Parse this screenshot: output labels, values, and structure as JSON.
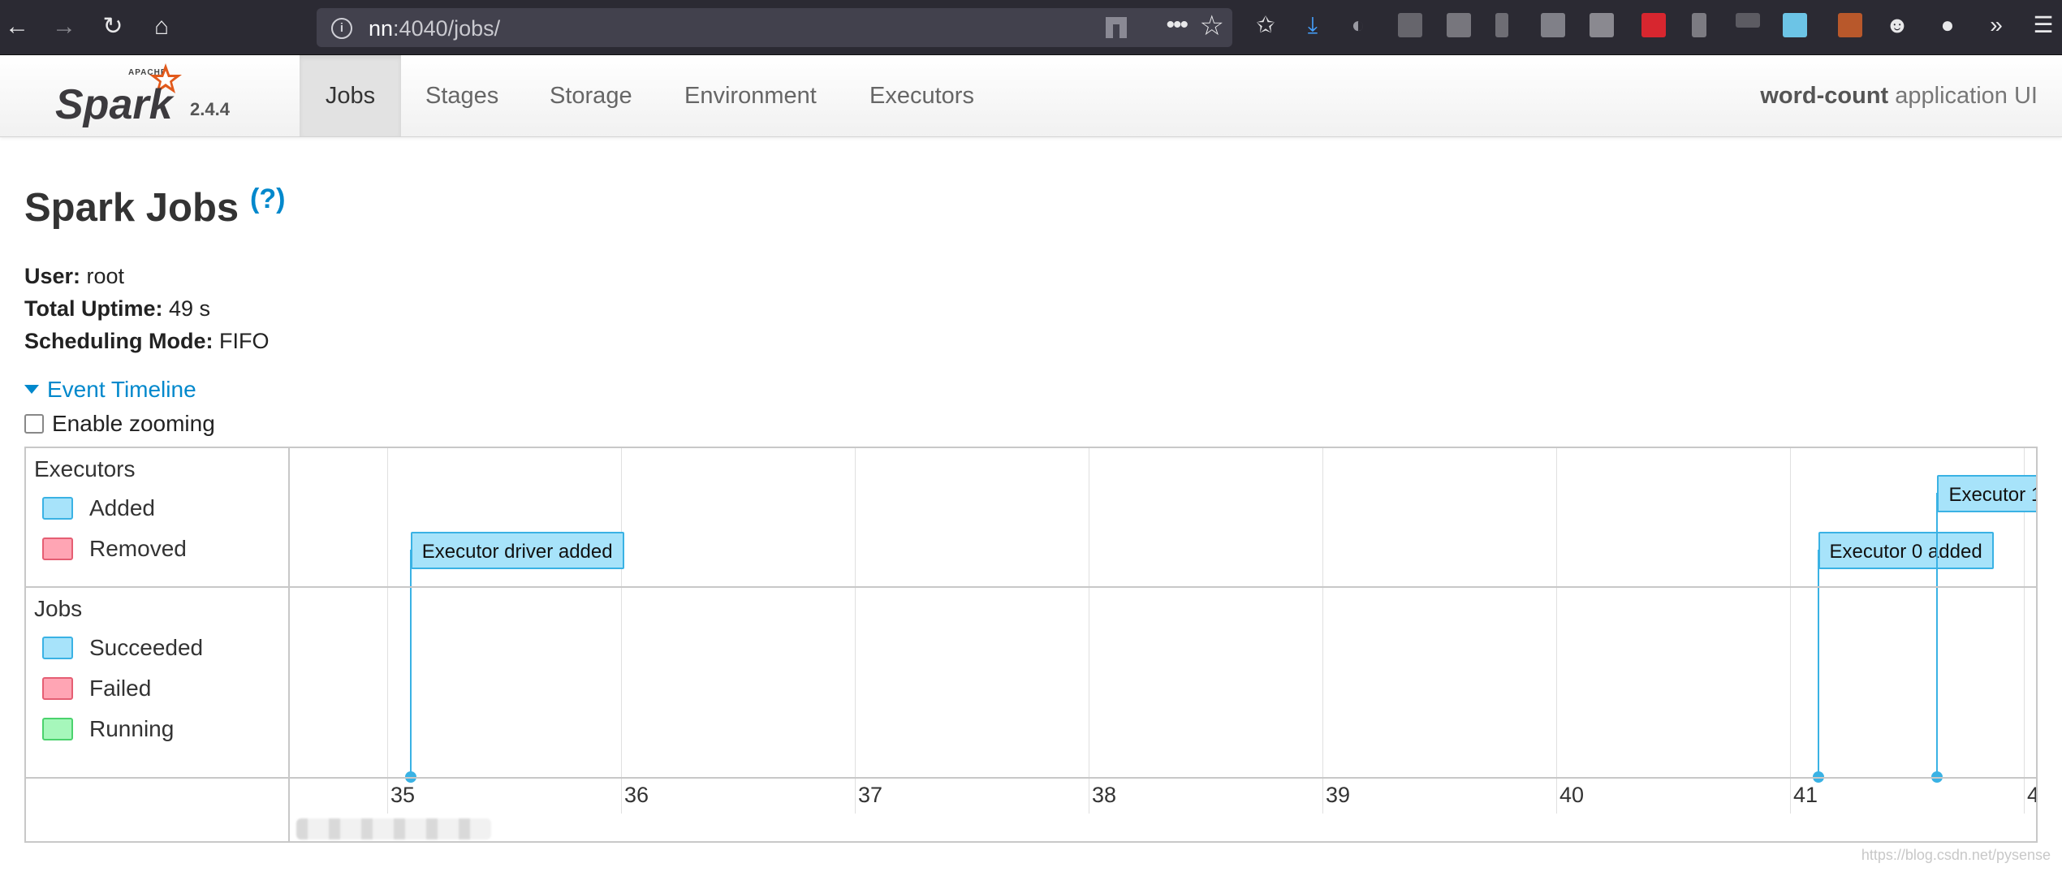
{
  "browser": {
    "url_host": "nn",
    "url_path": ":4040/jobs/"
  },
  "nav": {
    "version": "2.4.4",
    "tabs": [
      {
        "label": "Jobs",
        "active": true
      },
      {
        "label": "Stages",
        "active": false
      },
      {
        "label": "Storage",
        "active": false
      },
      {
        "label": "Environment",
        "active": false
      },
      {
        "label": "Executors",
        "active": false
      }
    ],
    "app_name": "word-count",
    "app_suffix": " application UI"
  },
  "page": {
    "title": "Spark Jobs",
    "help": "(?)",
    "info": [
      {
        "label": "User:",
        "value": " root"
      },
      {
        "label": "Total Uptime:",
        "value": " 49 s"
      },
      {
        "label": "Scheduling Mode:",
        "value": " FIFO"
      }
    ],
    "timeline_toggle": "Event Timeline",
    "enable_zooming": "Enable zooming",
    "enable_zooming_checked": false
  },
  "timeline": {
    "executors_title": "Executors",
    "executors_legend": [
      "Added",
      "Removed"
    ],
    "jobs_title": "Jobs",
    "jobs_legend": [
      "Succeeded",
      "Failed",
      "Running"
    ],
    "ticks": [
      "35",
      "36",
      "37",
      "38",
      "39",
      "40",
      "41",
      "4"
    ],
    "events": [
      {
        "label": "Executor driver added",
        "time": 35.1
      },
      {
        "label": "Executor 0 added",
        "time": 41.12
      },
      {
        "label": "Executor 1",
        "time": 41.63
      }
    ],
    "colors": {
      "added": "#a7e3fa",
      "removed": "#ffa5b4",
      "running": "#a6f7bb",
      "accent": "#3ab2e4"
    }
  },
  "watermark": "https://blog.csdn.net/pysense"
}
